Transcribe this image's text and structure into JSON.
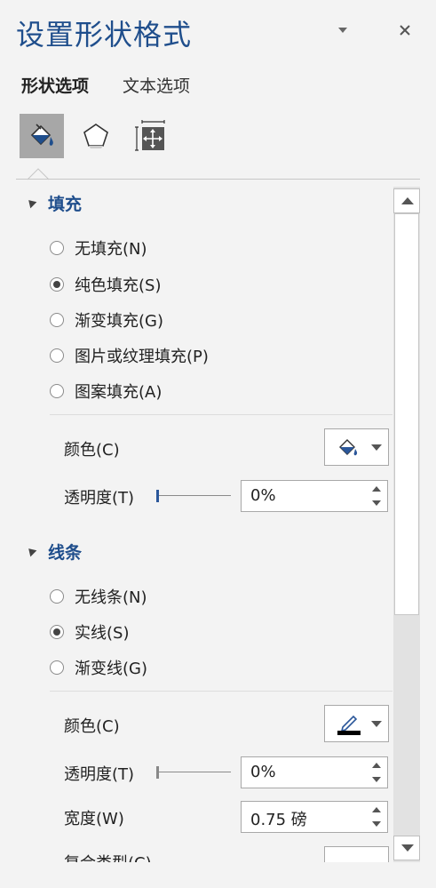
{
  "title": "设置形状格式",
  "tabs": [
    {
      "label": "形状选项",
      "active": true
    },
    {
      "label": "文本选项",
      "active": false
    }
  ],
  "category_icons": [
    "fill-line-icon",
    "effects-pentagon-icon",
    "size-properties-icon"
  ],
  "fill_section": {
    "header": "填充",
    "options": [
      {
        "label": "无填充(N)",
        "checked": false
      },
      {
        "label": "纯色填充(S)",
        "checked": true
      },
      {
        "label": "渐变填充(G)",
        "checked": false
      },
      {
        "label": "图片或纹理填充(P)",
        "checked": false
      },
      {
        "label": "图案填充(A)",
        "checked": false
      }
    ],
    "color_label": "颜色(C)",
    "transparency_label": "透明度(T)",
    "transparency_value": "0%"
  },
  "line_section": {
    "header": "线条",
    "options": [
      {
        "label": "无线条(N)",
        "checked": false
      },
      {
        "label": "实线(S)",
        "checked": true
      },
      {
        "label": "渐变线(G)",
        "checked": false
      }
    ],
    "color_label": "颜色(C)",
    "transparency_label": "透明度(T)",
    "transparency_value": "0%",
    "width_label": "宽度(W)",
    "width_value": "0.75 磅",
    "compound_label": "复合类型(C)"
  },
  "colors": {
    "accent": "#1f4e8c",
    "pane_bg": "#f3f3f3",
    "slider_thumb": "#2b579a"
  }
}
